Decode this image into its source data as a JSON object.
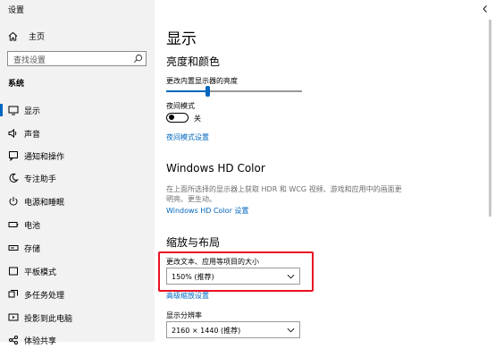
{
  "window": {
    "title": "设置",
    "controls": [
      "minimize",
      "maximize",
      "close"
    ]
  },
  "sidebar": {
    "home_label": "主页",
    "search_placeholder": "查找设置",
    "section_title": "系统",
    "items": [
      {
        "label": "显示",
        "icon": "display-icon",
        "active": true
      },
      {
        "label": "声音",
        "icon": "speaker-icon"
      },
      {
        "label": "通知和操作",
        "icon": "notification-icon"
      },
      {
        "label": "专注助手",
        "icon": "moon-icon"
      },
      {
        "label": "电源和睡眠",
        "icon": "power-icon"
      },
      {
        "label": "电池",
        "icon": "battery-icon"
      },
      {
        "label": "存储",
        "icon": "storage-icon"
      },
      {
        "label": "平板模式",
        "icon": "tablet-icon"
      },
      {
        "label": "多任务处理",
        "icon": "multitask-icon"
      },
      {
        "label": "投影到此电脑",
        "icon": "projector-icon"
      },
      {
        "label": "体验共享",
        "icon": "share-icon"
      }
    ]
  },
  "main": {
    "page_title": "显示",
    "brightness": {
      "heading": "亮度和颜色",
      "slider_label": "更改内置显示器的亮度",
      "slider_value_percent": 30,
      "night_mode_label": "夜间模式",
      "night_mode_state": "关",
      "night_mode_link": "夜间模式设置"
    },
    "hdr": {
      "heading": "Windows HD Color",
      "description": "在上面所选择的显示器上获取 HDR 和 WCG 视频、游戏和应用中的画面更明亮、更生动。",
      "link": "Windows HD Color 设置"
    },
    "scale": {
      "heading": "缩放与布局",
      "scale_label": "更改文本、应用等项目的大小",
      "scale_value": "150% (推荐)",
      "advanced_link": "高级缩放设置",
      "resolution_label": "显示分辨率",
      "resolution_value": "2160 × 1440 (推荐)"
    }
  },
  "colors": {
    "accent": "#0067c0",
    "highlight": "#e81123",
    "sidebar_bg": "#f2f2f2"
  }
}
